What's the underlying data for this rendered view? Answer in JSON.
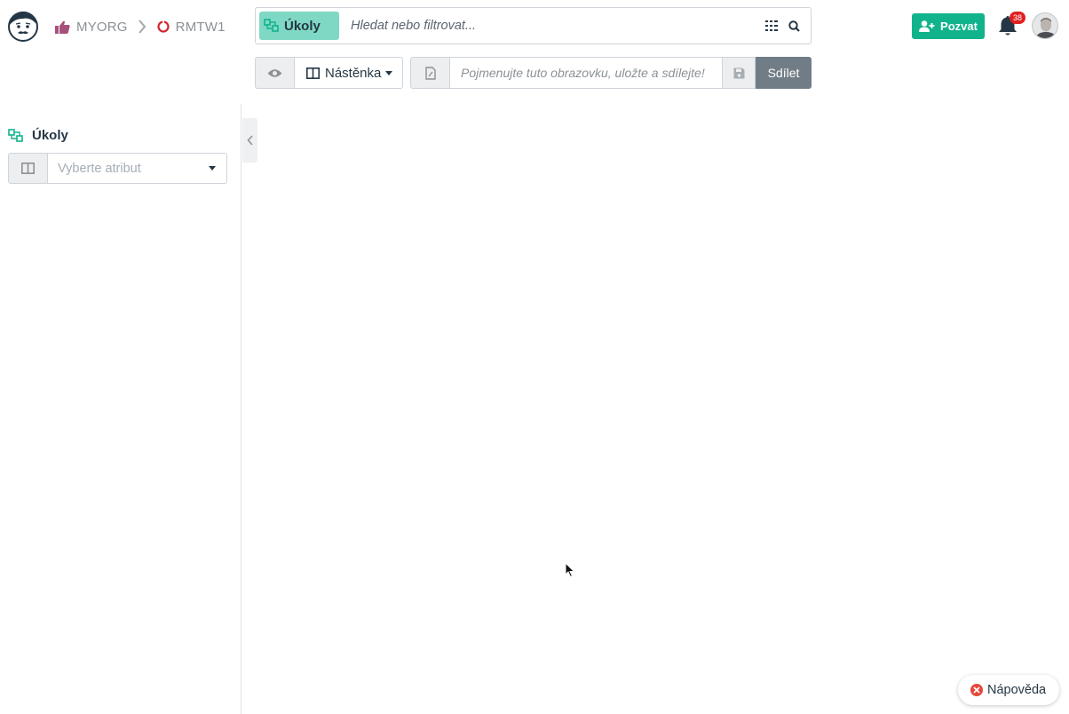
{
  "header": {
    "org": "MYORG",
    "project": "RMTW1",
    "search": {
      "chip_label": "Úkoly",
      "placeholder": "Hledat nebo filtrovat..."
    },
    "invite_label": "Pozvat",
    "notification_count": "38"
  },
  "toolbar": {
    "view_label": "Nástěnka",
    "perspective_placeholder": "Pojmenujte tuto obrazovku, uložte a sdílejte!",
    "share_label": "Sdílet"
  },
  "sidebar": {
    "collection_title": "Úkoly",
    "attribute_placeholder": "Vyberte atribut"
  },
  "help": {
    "label": "Nápověda"
  },
  "colors": {
    "accent": "#11b38c",
    "chip": "#7fd8c4",
    "share": "#717d86",
    "badge": "#e02020"
  }
}
